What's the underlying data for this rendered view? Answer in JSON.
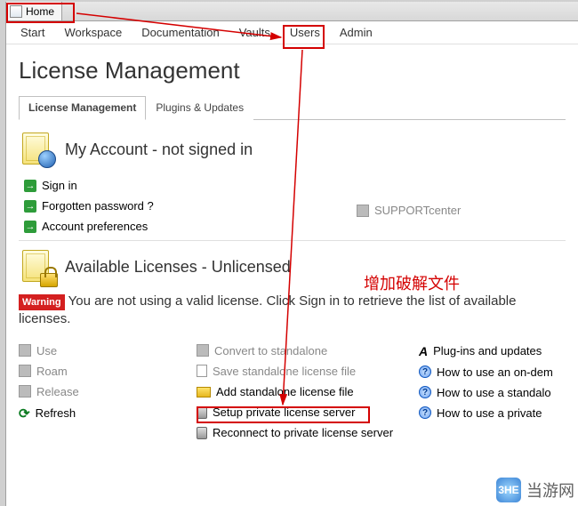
{
  "topbar": {
    "home_label": "Home"
  },
  "menu": [
    "Start",
    "Workspace",
    "Documentation",
    "Vaults",
    "Users",
    "Admin"
  ],
  "page_title": "License Management",
  "section_tabs": [
    "License Management",
    "Plugins & Updates"
  ],
  "account": {
    "title": "My Account - not signed in",
    "links": {
      "signin": "Sign in",
      "forgot": "Forgotten password ?",
      "prefs": "Account preferences",
      "support": "SUPPORTcenter"
    }
  },
  "licenses": {
    "title": "Available Licenses - Unlicensed",
    "warning_badge": "Warning",
    "warning_text": "You are not using a valid license. Click Sign in to retrieve the list of available licenses."
  },
  "actions": {
    "col1": {
      "use": "Use",
      "roam": "Roam",
      "release": "Release",
      "refresh": "Refresh"
    },
    "col2": {
      "convert": "Convert to standalone",
      "save": "Save standalone license file",
      "add": "Add standalone license file",
      "setup": "Setup private license server",
      "reconnect": "Reconnect to private license server"
    },
    "col3": {
      "plugins": "Plug-ins and updates",
      "howto_ondem": "How to use an on-dem",
      "howto_standalone": "How to use a standalo",
      "howto_private": "How to use a private"
    }
  },
  "annotation": {
    "label": "增加破解文件"
  },
  "watermark": {
    "logo": "3HE",
    "text": "当游网"
  }
}
